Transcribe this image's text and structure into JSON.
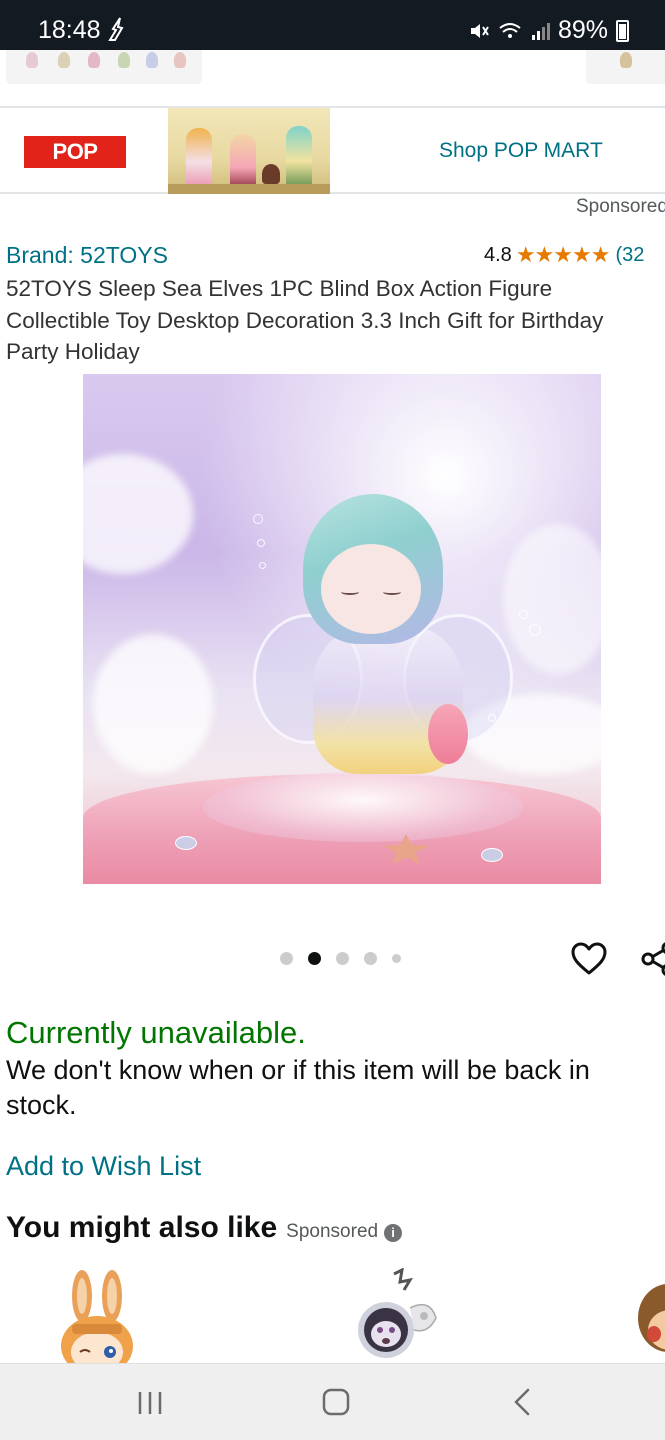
{
  "status_bar": {
    "time": "18:48",
    "battery": "89%"
  },
  "brand_banner": {
    "logo_text": "POP MART",
    "link_label": "Shop POP MART"
  },
  "product": {
    "sponsored_label": "Sponsored",
    "brand": "Brand: 52TOYS",
    "rating_value": "4.8",
    "stars": "★★★★★",
    "rating_count": "(32",
    "title": "52TOYS Sleep Sea Elves 1PC Blind Box Action Figure Collectible Toy Desktop Decoration 3.3 Inch Gift for Birthday Party Holiday",
    "image_page_index": 2,
    "image_page_count": 5
  },
  "availability": {
    "status": "Currently unavailable.",
    "description": "We don't know when or if this item will be back in stock."
  },
  "actions": {
    "wishlist_label": "Add to Wish List"
  },
  "recommendations": {
    "title": "You might also like",
    "sponsored_label": "Sponsored",
    "info_icon": "i"
  },
  "icons": {
    "heart": "heart-icon",
    "share": "share-icon",
    "recents": "recent-apps-icon",
    "home": "home-icon",
    "back": "back-icon"
  },
  "colors": {
    "link": "#007185",
    "available_status": "#007600",
    "star": "#e67a00",
    "popmart_red": "#e2231a",
    "status_bar_bg": "#131a22"
  }
}
